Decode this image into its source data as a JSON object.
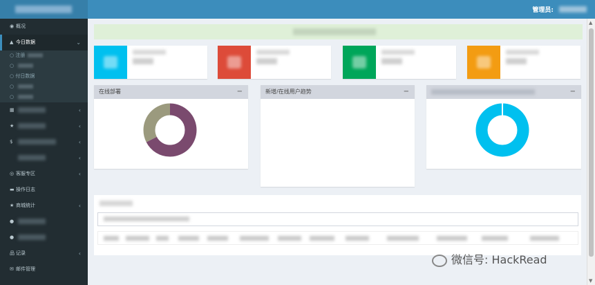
{
  "header": {
    "admin_label": "管理员:"
  },
  "sidebar": {
    "items": [
      {
        "icon": "dashboard-icon",
        "glyph": "◉",
        "label": "概况"
      },
      {
        "icon": "bell-icon",
        "glyph": "▲",
        "label": "今日数据",
        "chevron": "⌄"
      },
      {
        "icon": "calendar-icon",
        "glyph": "▦",
        "label": "",
        "chevron": "‹"
      },
      {
        "icon": "star-icon",
        "glyph": "★",
        "label": "",
        "chevron": "‹"
      },
      {
        "icon": "dollar-icon",
        "glyph": "$",
        "label": "",
        "chevron": "‹"
      },
      {
        "icon": "blank-icon",
        "glyph": "",
        "label": "",
        "chevron": "‹"
      },
      {
        "icon": "headset-icon",
        "glyph": "◎",
        "label": "客服专区",
        "chevron": "‹"
      },
      {
        "icon": "folder-icon",
        "glyph": "▬",
        "label": "操作日志"
      },
      {
        "icon": "star-icon",
        "glyph": "★",
        "label": "商城统计",
        "chevron": "‹"
      },
      {
        "icon": "user-icon",
        "glyph": "●",
        "label": ""
      },
      {
        "icon": "user-icon",
        "glyph": "●",
        "label": ""
      },
      {
        "icon": "sitemap-icon",
        "glyph": "品",
        "label": "记录",
        "chevron": "‹"
      },
      {
        "icon": "envelope-icon",
        "glyph": "✉",
        "label": "邮件管理"
      }
    ],
    "subitems": [
      {
        "label": "注册"
      },
      {
        "label": ""
      },
      {
        "label": "付日数据"
      },
      {
        "label": ""
      },
      {
        "label": ""
      }
    ]
  },
  "boxes": {
    "online_deploy": {
      "title": "在线部署",
      "minimize": "−"
    },
    "new_online_trend": {
      "title": "新增/在线用户趋势",
      "minimize": "−"
    },
    "third": {
      "title": "",
      "minimize": "−"
    }
  },
  "colors": {
    "header": "#3c8dbc",
    "sidebar": "#222d32",
    "aqua": "#00c0ef",
    "red": "#dd4b39",
    "green": "#00a65a",
    "yellow": "#f39c12",
    "donut_purple": "#7a4a6e",
    "donut_olive": "#9b9a7e",
    "donut_cyan": "#00c0ef"
  },
  "watermark": {
    "text": "微信号: HackRead"
  }
}
